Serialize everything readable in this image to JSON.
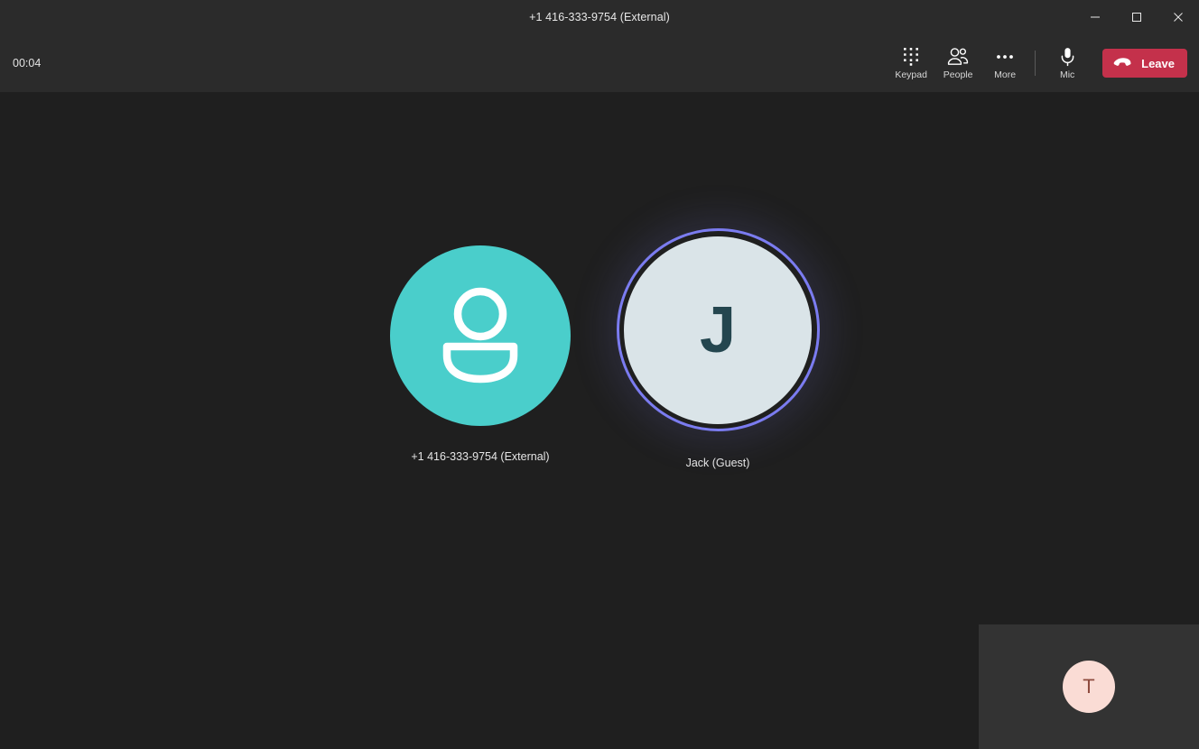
{
  "window": {
    "title": "+1 416-333-9754 (External)",
    "controls": [
      {
        "name": "minimize",
        "label": "Minimize"
      },
      {
        "name": "maximize",
        "label": "Maximize"
      },
      {
        "name": "close",
        "label": "Close"
      }
    ]
  },
  "toolbar": {
    "timer": "00:04",
    "actions": [
      {
        "label": "Keypad",
        "icon": "keypad-icon"
      },
      {
        "label": "People",
        "icon": "people-icon"
      },
      {
        "label": "More",
        "icon": "more-icon"
      },
      {
        "label": "Mic",
        "icon": "microphone-icon"
      }
    ],
    "leave_label": "Leave",
    "leave_icon": "hangup-icon",
    "leave_color": "#c4314b"
  },
  "stage": {
    "participants": [
      {
        "name": "+1 416-333-9754 (External)",
        "avatar_type": "person-icon",
        "avatar_color": "#4acecb",
        "speaking": false
      },
      {
        "name": "Jack (Guest)",
        "avatar_type": "initial",
        "initial": "J",
        "avatar_color": "#dae4e8",
        "initial_color": "#24464f",
        "speaking": true,
        "ring_color": "#7b7cf0"
      }
    ]
  },
  "selfview": {
    "initial": "T",
    "avatar_color": "#fadcd5",
    "initial_color": "#8e4b3e"
  },
  "colors": {
    "titlebar_bg": "#2b2b2b",
    "toolbar_bg": "#2b2b2b",
    "stage_bg": "#1f1f1f",
    "selfview_bg": "#333333"
  }
}
